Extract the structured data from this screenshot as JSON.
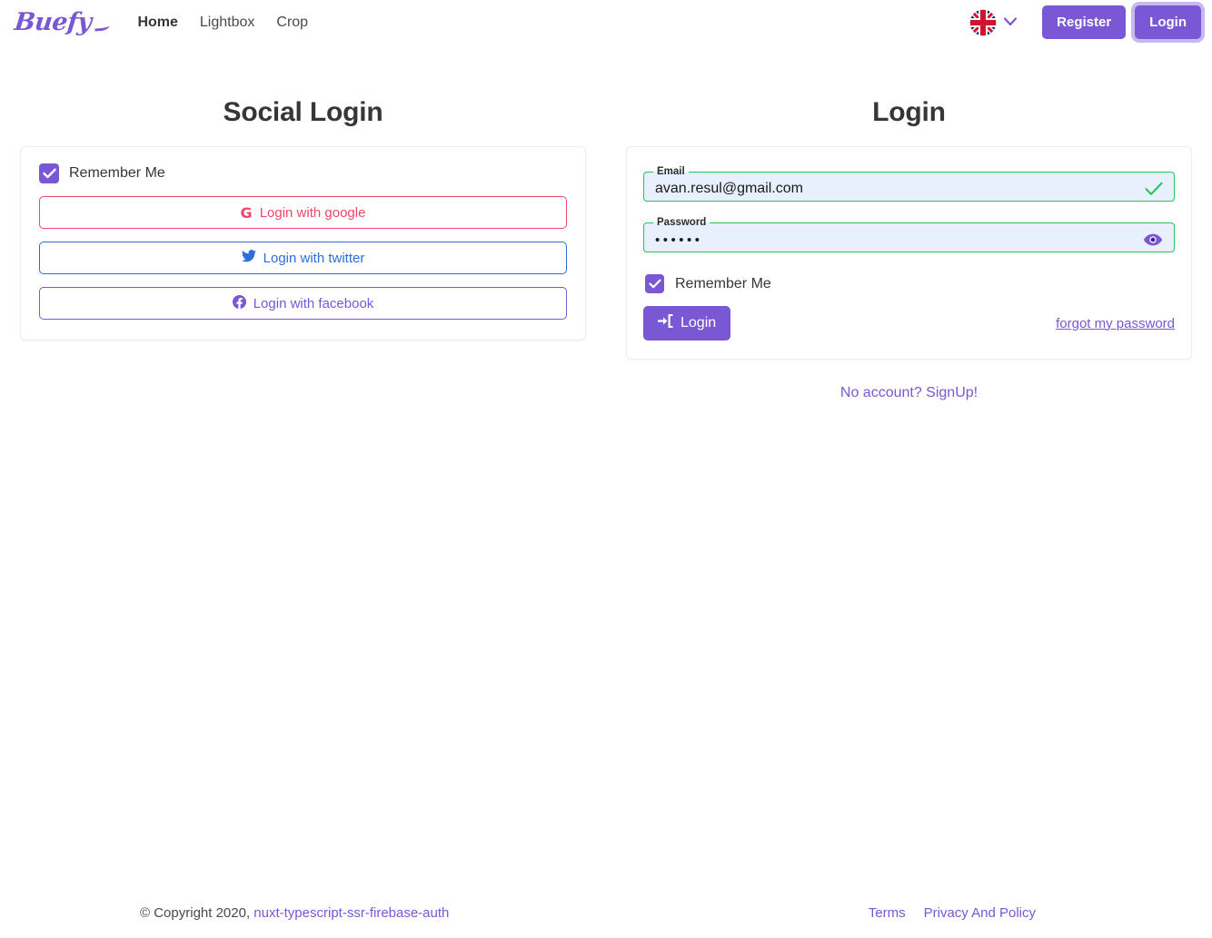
{
  "navbar": {
    "brand": "Buefy",
    "links": [
      {
        "label": "Home",
        "active": true
      },
      {
        "label": "Lightbox",
        "active": false
      },
      {
        "label": "Crop",
        "active": false
      }
    ],
    "language": {
      "icon": "uk-flag-icon",
      "chevron": "chevron-down-icon"
    },
    "register_label": "Register",
    "login_label": "Login"
  },
  "social": {
    "title": "Social Login",
    "remember": {
      "label": "Remember Me",
      "checked": true
    },
    "buttons": [
      {
        "label": "Login with google",
        "icon": "google-icon",
        "color": "#f14668"
      },
      {
        "label": "Login with twitter",
        "icon": "twitter-icon",
        "color": "#2d6fd8"
      },
      {
        "label": "Login with facebook",
        "icon": "facebook-icon",
        "color": "#7957d5"
      }
    ]
  },
  "login": {
    "title": "Login",
    "email": {
      "label": "Email",
      "value": "avan.resul@gmail.com",
      "placeholder": "Email",
      "valid": true,
      "validation_icon": "check-icon"
    },
    "password": {
      "label": "Password",
      "value": "••••••",
      "placeholder": "Password",
      "valid": true,
      "reveal_icon": "eye-icon"
    },
    "remember": {
      "label": "Remember Me",
      "checked": true
    },
    "submit_label": "Login",
    "submit_icon": "sign-in-icon",
    "forgot_label": "forgot my password",
    "signup_label": "No account? SignUp!"
  },
  "footer": {
    "copyright_prefix": "© Copyright 2020,",
    "project_link": "nuxt-typescript-ssr-firebase-auth",
    "terms_label": "Terms",
    "privacy_label": "Privacy And Policy"
  },
  "colors": {
    "primary": "#7957d5",
    "success": "#22c55e",
    "danger": "#f14668",
    "twitter": "#2d6fd8",
    "autofill_bg": "#e8f0fe"
  }
}
